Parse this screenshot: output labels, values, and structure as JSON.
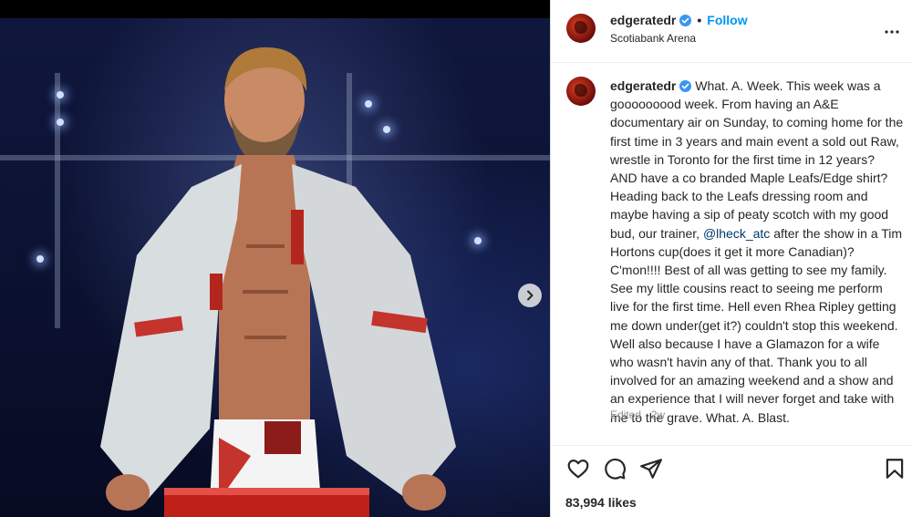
{
  "post": {
    "username": "edgeratedr",
    "follow_label": "Follow",
    "separator": "•",
    "location": "Scotiabank Arena",
    "caption_before_mention": "What. A. Week. This week was a gooooooood week. From having an A&E documentary air on Sunday, to coming home for the first time in 3 years and main event a sold out Raw, wrestle in Toronto for the first time in 12 years? AND have a co branded Maple Leafs/Edge shirt? Heading back to the Leafs dressing room and maybe having a sip of peaty scotch with my good bud, our trainer, ",
    "mention": "@lheck_atc",
    "caption_after_mention": " after the show in a Tim Hortons cup(does it get it more Canadian)? C'mon!!!! Best of all was getting to see my family. See my little cousins react to seeing me perform live for the first time. Hell even Rhea Ripley getting me down under(get it?) couldn't stop this weekend. Well also because I have a Glamazon for a wife who wasn't havin any of that. Thank you to all involved for an amazing weekend and a show and an experience that I will never forget and take with me to the grave. What. A. Blast.",
    "edited_label": "Edited",
    "meta_separator": "·",
    "age": "2w",
    "likes": "83,994 likes"
  },
  "colors": {
    "accent": "#0095f6",
    "verified": "#3897f0",
    "text": "#262626",
    "muted": "#8e8e8e",
    "mention": "#00376b"
  },
  "icons": {
    "verified": "verified-badge-icon",
    "more": "more-options-icon",
    "like": "heart-icon",
    "comment": "comment-icon",
    "share": "paper-plane-icon",
    "save": "bookmark-icon",
    "next": "chevron-right-icon"
  }
}
